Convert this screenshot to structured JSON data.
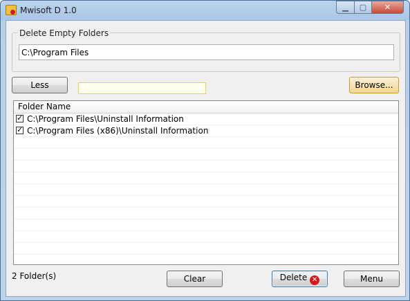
{
  "window": {
    "title": "Mwisoft D 1.0",
    "controls": {
      "minimize": "▁",
      "maximize": "▢",
      "close": "✕"
    }
  },
  "group": {
    "legend": "Delete Empty Folders",
    "path_value": "C:\\Program Files"
  },
  "toolbar": {
    "less_label": "Less",
    "filter_value": "",
    "browse_label": "Browse..."
  },
  "list": {
    "column_header": "Folder Name",
    "items": [
      {
        "path": "C:\\Program Files\\Uninstall Information",
        "checked": true
      },
      {
        "path": "C:\\Program Files (x86)\\Uninstall Information",
        "checked": true
      }
    ]
  },
  "footer": {
    "status": "2 Folder(s)",
    "clear_label": "Clear",
    "delete_label": "Delete",
    "menu_label": "Menu"
  },
  "icons": {
    "app_icon": "folder-icon",
    "delete_icon": "close-circle-icon",
    "check_icon": "checkmark-icon"
  },
  "colors": {
    "titlebar": "#a9c6e6",
    "close_button": "#c84a36",
    "delete_icon": "#d21c1c"
  }
}
